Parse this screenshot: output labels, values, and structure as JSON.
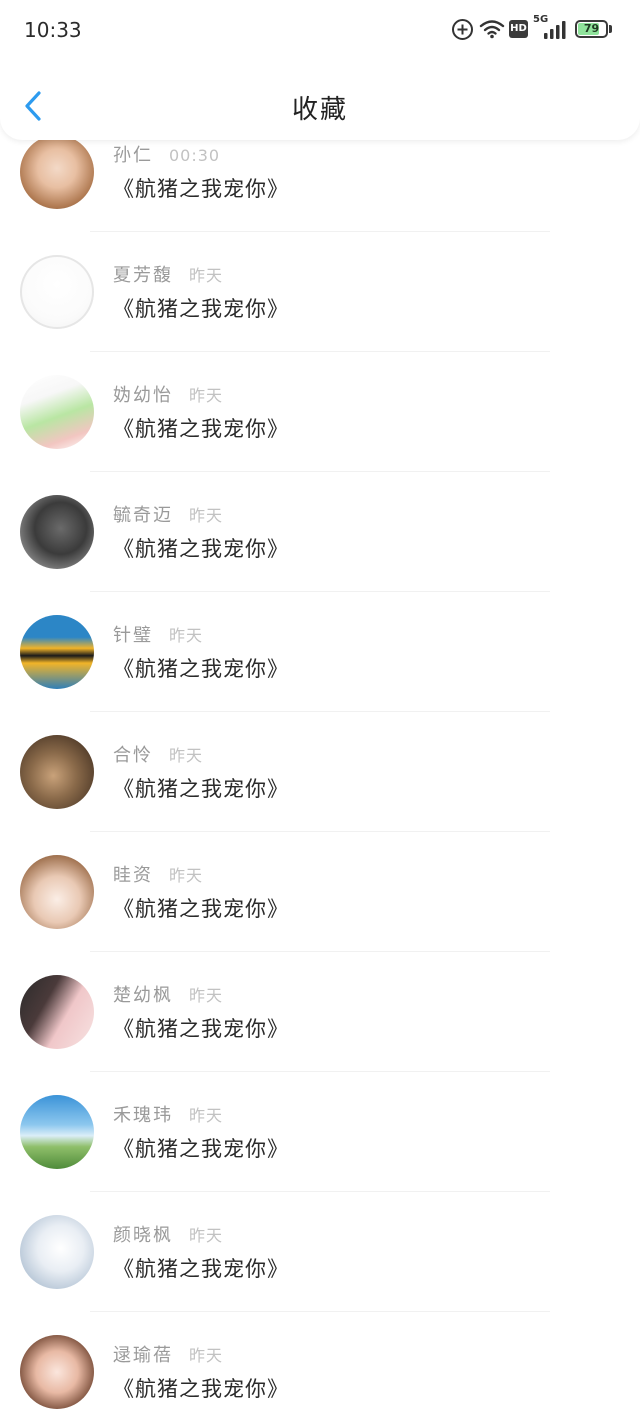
{
  "status_bar": {
    "time": "10:33",
    "hd": "HD",
    "network": "5G",
    "battery": "79",
    "battery_level": 0.79,
    "battery_color": "#8fe39b",
    "icons": [
      "add-circle-icon",
      "wifi-icon",
      "hd-icon",
      "signal-icon",
      "battery-icon"
    ]
  },
  "header": {
    "title": "收藏",
    "back_icon": "chevron-left-icon",
    "accent_color": "#2d9bef"
  },
  "list": {
    "items": [
      {
        "name": "孙仁",
        "time": "00:30",
        "title": "《航猪之我宠你》"
      },
      {
        "name": "夏芳馥",
        "time": "昨天",
        "title": "《航猪之我宠你》"
      },
      {
        "name": "妫幼怡",
        "time": "昨天",
        "title": "《航猪之我宠你》"
      },
      {
        "name": "毓奇迈",
        "time": "昨天",
        "title": "《航猪之我宠你》"
      },
      {
        "name": "针璧",
        "time": "昨天",
        "title": "《航猪之我宠你》"
      },
      {
        "name": "合怜",
        "time": "昨天",
        "title": "《航猪之我宠你》"
      },
      {
        "name": "眭资",
        "time": "昨天",
        "title": "《航猪之我宠你》"
      },
      {
        "name": "楚幼枫",
        "time": "昨天",
        "title": "《航猪之我宠你》"
      },
      {
        "name": "禾瑰玮",
        "time": "昨天",
        "title": "《航猪之我宠你》"
      },
      {
        "name": "颜晓枫",
        "time": "昨天",
        "title": "《航猪之我宠你》"
      },
      {
        "name": "逯瑜蓓",
        "time": "昨天",
        "title": "《航猪之我宠你》"
      }
    ]
  }
}
